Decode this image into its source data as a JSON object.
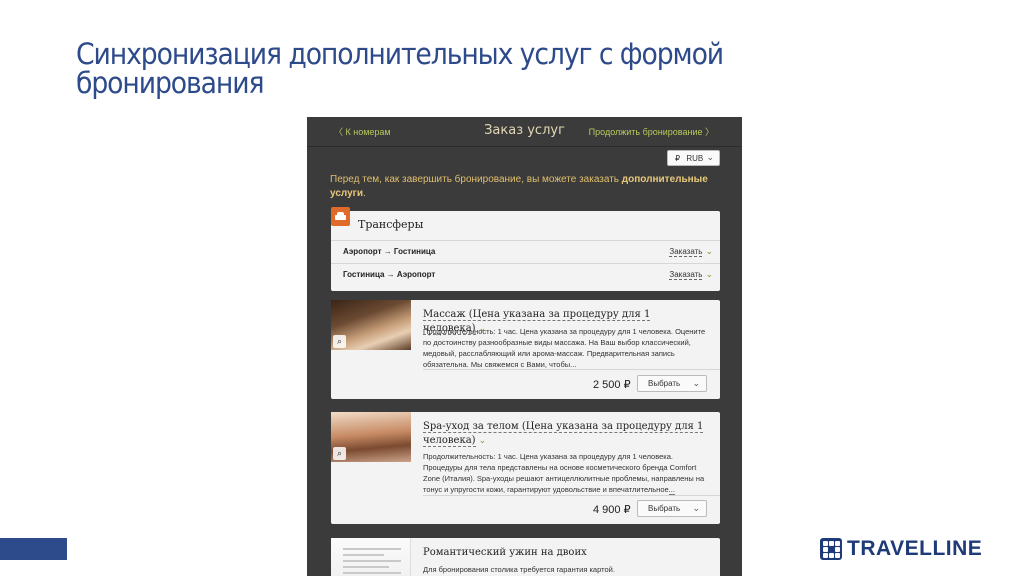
{
  "slide": {
    "title": "Синхронизация дополнительных услуг с формой бронирования",
    "logo_text": "TRAVELLINE",
    "accent_color": "#2d4a8a"
  },
  "app": {
    "back_label": "〈 К номерам",
    "title": "Заказ услуг",
    "continue_label": "Продолжить бронирование 〉",
    "currency": {
      "symbol": "₽",
      "value": "RUB"
    },
    "intro_prefix": "Перед тем, как завершить бронирование, вы можете заказать ",
    "intro_bold": "дополнительные услуги",
    "intro_suffix": ".",
    "transfers": {
      "title": "Трансферы",
      "icon": "car-icon",
      "routes": [
        {
          "label": "Аэропорт → Гостиница",
          "action": "Заказать"
        },
        {
          "label": "Гостиница → Аэропорт",
          "action": "Заказать"
        }
      ]
    },
    "services": [
      {
        "title": "Массаж (Цена указана за процедуру для 1 человека)",
        "desc": "Продолжительность: 1 час. Цена указана за процедуру для 1 человека. Оцените по достоинству разнообразные виды массажа. На Ваш выбор классический, медовый, расслабляющий или арома-массаж. Предварительная запись обязательна. Мы свяжемся с Вами, чтобы",
        "more": "...",
        "price": "2 500 ₽",
        "select": "Выбрать"
      },
      {
        "title": "Spa-уход за телом (Цена указана за процедуру для 1 человека)",
        "desc": "Продолжительность: 1 час. Цена указана за процедуру для 1 человека. Процедуры для тела представлены на основе косметического бренда Comfort Zone (Италия). Spa-уходы решают антицеллюлитные проблемы, направлены на тонус и упругости кожи, гарантируют удовольствие и впечатлительное",
        "more": "...",
        "price": "4 900 ₽",
        "select": "Выбрать"
      },
      {
        "title": "Романтический ужин на двоих",
        "desc": "Для бронирования столика требуется гарантия картой."
      }
    ]
  }
}
